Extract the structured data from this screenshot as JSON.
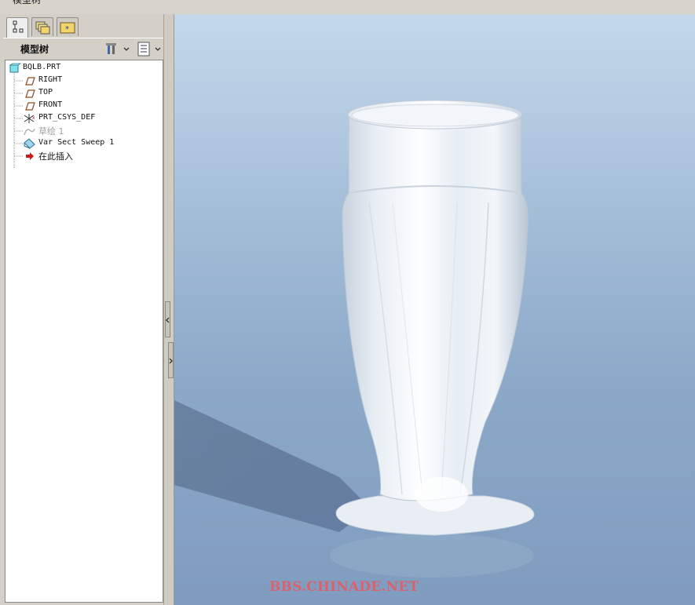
{
  "window": {
    "title": "模型树"
  },
  "panel": {
    "title": "模型树",
    "tabs": [
      {
        "name": "model-tree-tab",
        "icon": "tree-icon"
      },
      {
        "name": "folder-browser-tab",
        "icon": "layers-icon"
      },
      {
        "name": "favorites-tab",
        "icon": "star-folder-icon"
      }
    ],
    "header_buttons": [
      "settings-tools-icon",
      "show-menu-icon"
    ]
  },
  "tree": {
    "root": "BQLB.PRT",
    "items": [
      {
        "label": "RIGHT",
        "icon": "datum-plane-icon",
        "state": "normal"
      },
      {
        "label": "TOP",
        "icon": "datum-plane-icon",
        "state": "normal"
      },
      {
        "label": "FRONT",
        "icon": "datum-plane-icon",
        "state": "normal"
      },
      {
        "label": "PRT_CSYS_DEF",
        "icon": "coordinate-system-icon",
        "state": "normal"
      },
      {
        "label": "草绘 1",
        "icon": "sketch-icon",
        "state": "hidden"
      },
      {
        "label": "Var Sect Sweep 1",
        "icon": "sweep-feature-icon",
        "state": "normal"
      },
      {
        "label": "在此插入",
        "icon": "insert-here-arrow-icon",
        "state": "insert"
      }
    ]
  },
  "viewport": {
    "watermark": "BBS.CHINADE.NET",
    "background_top": "#c4d8ea",
    "background_bottom": "#7f9cbf",
    "model_color": "#eef3f8"
  }
}
